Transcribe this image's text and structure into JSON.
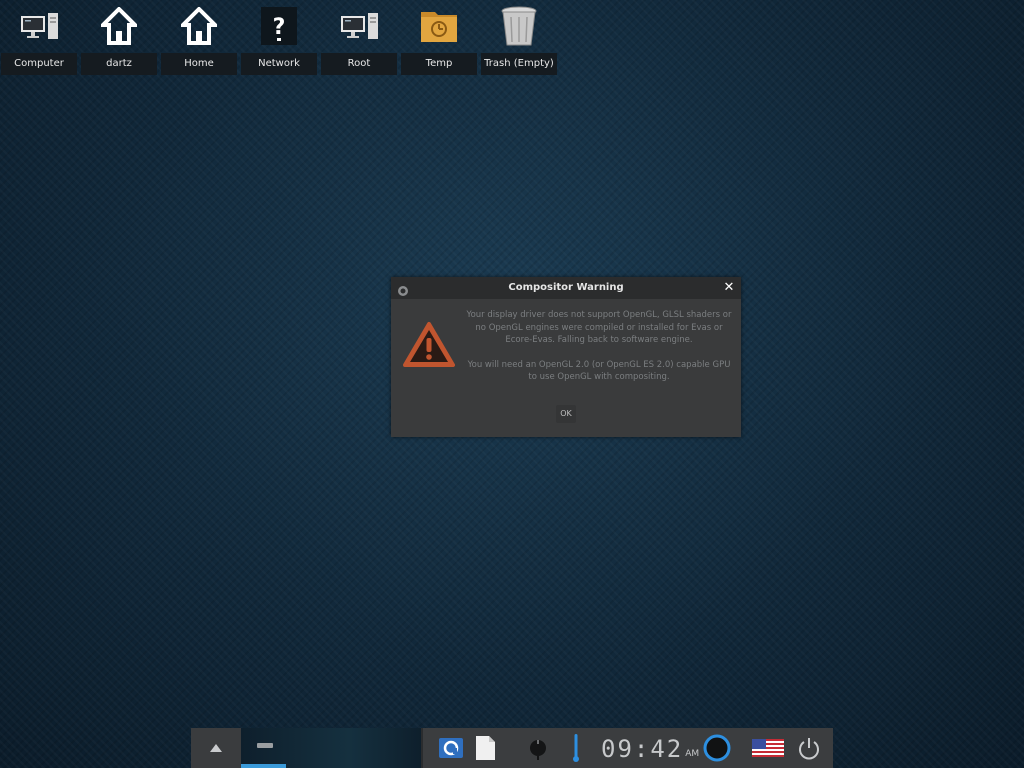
{
  "desktop": {
    "icons": [
      {
        "label": "Computer",
        "icon": "computer-icon"
      },
      {
        "label": "dartz",
        "icon": "home-icon"
      },
      {
        "label": "Home",
        "icon": "home-icon"
      },
      {
        "label": "Network",
        "icon": "network-unknown-icon"
      },
      {
        "label": "Root",
        "icon": "computer-icon"
      },
      {
        "label": "Temp",
        "icon": "folder-temp-icon"
      },
      {
        "label": "Trash (Empty)",
        "icon": "trash-icon"
      }
    ]
  },
  "dialog": {
    "title": "Compositor Warning",
    "message_1": "Your display driver does not support OpenGL, GLSL shaders or no OpenGL engines were compiled or installed for Evas or Ecore-Evas. Falling back to software engine.",
    "message_2": "You will need an OpenGL 2.0 (or OpenGL ES 2.0) capable GPU to use OpenGL with compositing.",
    "ok_label": "OK",
    "close_glyph": "✕",
    "warning_color": "#c0552f"
  },
  "taskbar": {
    "clock_time": "09:42",
    "clock_ampm": "AM",
    "accent_color": "#3a9ad9",
    "tray_icons": [
      "shutter-icon",
      "document-icon",
      "mixer-knob-icon",
      "thermometer-icon",
      "clock-ring-icon",
      "us-flag-icon",
      "power-icon"
    ]
  }
}
